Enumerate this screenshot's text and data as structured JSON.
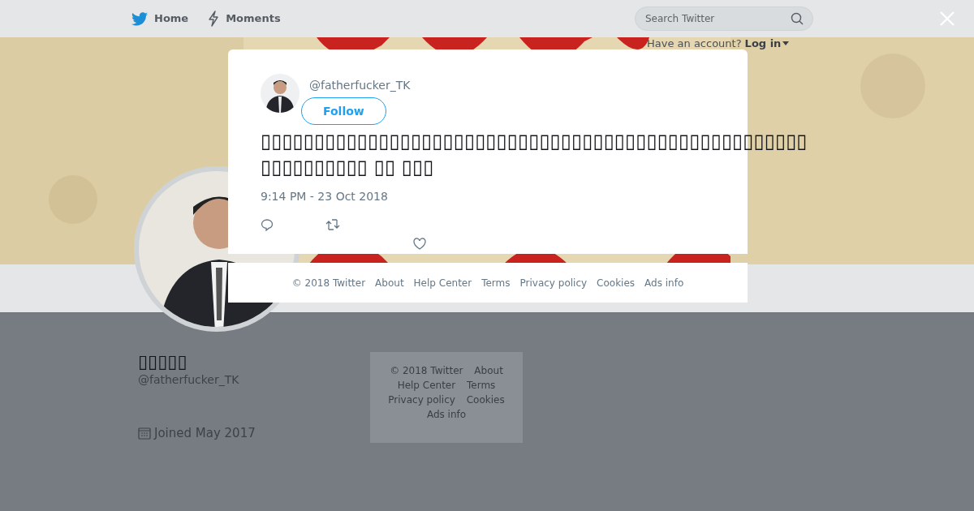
{
  "top_nav": {
    "items": [
      {
        "label": "Home",
        "kind": "bird"
      },
      {
        "label": "Moments",
        "kind": "bolt"
      }
    ],
    "search": {
      "placeholder": "Search Twitter"
    },
    "login_prompt": {
      "text": "Have an account?",
      "link": "Log in"
    }
  },
  "profile": {
    "name": "▯▯▯▯▯",
    "handle": "@fatherfucker_TK",
    "joined": "Joined May 2017"
  },
  "side_footer": {
    "links": [
      "© 2018 Twitter",
      "About",
      "Help Center",
      "Terms",
      "Privacy policy",
      "Cookies",
      "Ads info"
    ]
  },
  "tweet_modal": {
    "handle": "@fatherfucker_TK",
    "follow_button": "Follow",
    "text_lines": [
      "▯▯▯▯▯▯▯▯▯▯▯▯▯▯▯▯▯▯▯▯▯▯▯▯▯▯▯▯▯▯▯▯▯▯▯▯▯▯▯▯▯▯▯▯▯▯▯▯▯▯▯",
      "▯▯▯▯▯▯▯▯▯▯ ▯▯ ▯▯▯"
    ],
    "timestamp": "9:14 PM - 23 Oct 2018"
  },
  "modal_footer": {
    "links": [
      "© 2018 Twitter",
      "About",
      "Help Center",
      "Terms",
      "Privacy policy",
      "Cookies",
      "Ads info"
    ]
  }
}
